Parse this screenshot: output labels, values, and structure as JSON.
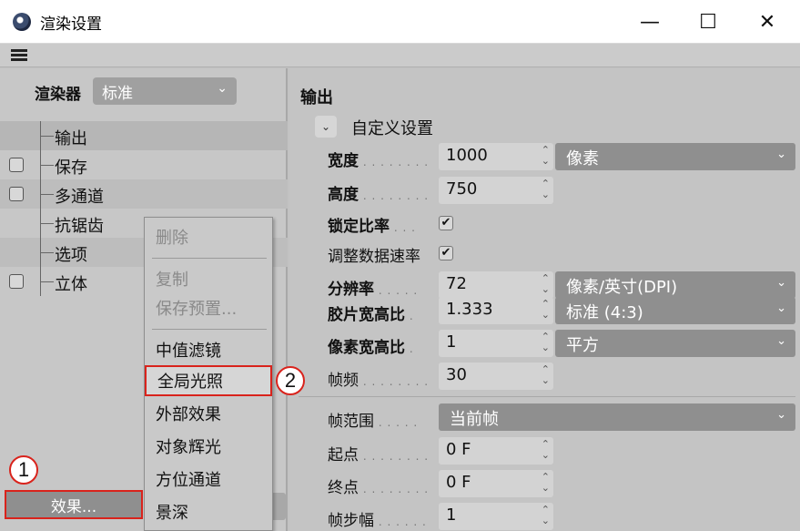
{
  "window": {
    "title": "渲染设置",
    "minimize": "—",
    "maximize": "☐",
    "close": "✕"
  },
  "left": {
    "renderer_label": "渲染器",
    "renderer_value": "标准",
    "tree": [
      {
        "label": "输出",
        "checkbox": false
      },
      {
        "label": "保存",
        "checkbox": true
      },
      {
        "label": "多通道",
        "checkbox": true
      },
      {
        "label": "抗锯齿",
        "checkbox": false
      },
      {
        "label": "选项",
        "checkbox": false
      },
      {
        "label": "立体",
        "checkbox": true
      }
    ],
    "effect_button": "效果..."
  },
  "menu": {
    "items": [
      "删除",
      "复制",
      "保存预置...",
      "中值滤镜",
      "全局光照",
      "外部效果",
      "对象辉光",
      "方位通道",
      "景深"
    ]
  },
  "callouts": [
    "1",
    "2"
  ],
  "right": {
    "section": "输出",
    "preset": "自定义设置",
    "width_label": "宽度",
    "width_value": "1000",
    "unit_value": "像素",
    "height_label": "高度",
    "height_value": "750",
    "lock_label": "锁定比率",
    "adapt_label": "调整数据速率",
    "resolution_label": "分辨率",
    "resolution_value": "72",
    "resolution_unit": "像素/英寸(DPI)",
    "film_label": "胶片宽高比",
    "film_value": "1.333",
    "film_preset": "标准 (4:3)",
    "pixel_label": "像素宽高比",
    "pixel_value": "1",
    "pixel_preset": "平方",
    "fps_label": "帧频",
    "fps_value": "30",
    "range_label": "帧范围",
    "range_value": "当前帧",
    "start_label": "起点",
    "start_value": "0 F",
    "end_label": "终点",
    "end_value": "0 F",
    "step_label": "帧步幅",
    "step_value": "1"
  }
}
